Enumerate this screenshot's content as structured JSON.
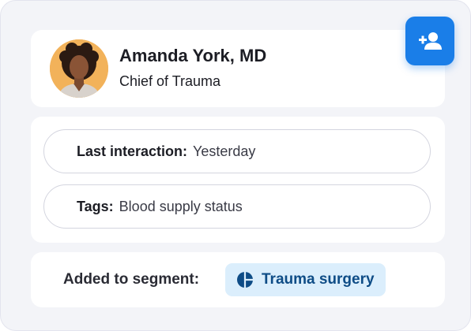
{
  "contact": {
    "name": "Amanda York, MD",
    "title": "Chief of Trauma",
    "avatar_icon": "person-portrait"
  },
  "actions": {
    "add_contact_icon": "person-add-icon"
  },
  "details": {
    "last_interaction_label": "Last interaction:",
    "last_interaction_value": "Yesterday",
    "tags_label": "Tags:",
    "tags_value": "Blood supply status"
  },
  "segment": {
    "label": "Added to segment:",
    "name": "Trauma surgery",
    "icon": "pie-chart-icon"
  },
  "colors": {
    "accent": "#1a7ee8",
    "chip_bg": "#dbeefc",
    "chip_text": "#0e4c86"
  }
}
